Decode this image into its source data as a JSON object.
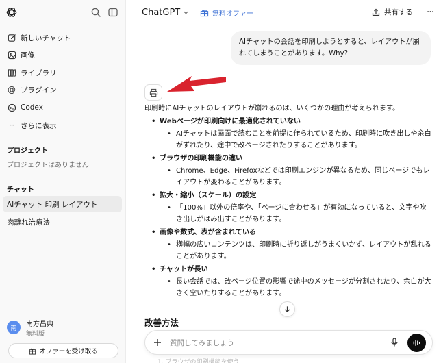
{
  "sidebar": {
    "nav": [
      {
        "label": "新しいチャット",
        "icon": "edit-icon"
      },
      {
        "label": "画像",
        "icon": "image-icon"
      },
      {
        "label": "ライブラリ",
        "icon": "library-icon"
      },
      {
        "label": "プラグイン",
        "icon": "at-icon"
      },
      {
        "label": "Codex",
        "icon": "codex-icon"
      },
      {
        "label": "さらに表示",
        "icon": "dots-icon"
      }
    ],
    "projects_heading": "プロジェクト",
    "projects_empty": "プロジェクトはありません",
    "chats_heading": "チャット",
    "chats": [
      {
        "label": "AIチャット 印刷 レイアウト",
        "active": true
      },
      {
        "label": "肉離れ治療法",
        "active": false
      }
    ],
    "user": {
      "name": "南方昌典",
      "plan": "無料版",
      "avatar_text": "南"
    },
    "offer_button": "オファーを受け取る"
  },
  "header": {
    "model": "ChatGPT",
    "free_offer": "無料オファー",
    "share": "共有する"
  },
  "conversation": {
    "user_message": "AIチャットの会話を印刷しようとすると、レイアウトが崩れてしまうことがあります。Why?",
    "intro": "印刷時にAIチャットのレイアウトが崩れるのは、いくつかの理由が考えられます。",
    "points": [
      {
        "title": "Webページが印刷向けに最適化されていない",
        "detail": "AIチャットは画面で読むことを前提に作られているため、印刷時に吹き出しや余白がずれたり、途中で改ページされたりすることがあります。"
      },
      {
        "title": "ブラウザの印刷機能の違い",
        "detail": "Chrome、Edge、Firefoxなどでは印刷エンジンが異なるため、同じページでもレイアウトが変わることがあります。"
      },
      {
        "title": "拡大・縮小（スケール）の設定",
        "detail": "「100%」以外の倍率や、「ページに合わせる」が有効になっていると、文字や吹き出しがはみ出すことがあります。"
      },
      {
        "title": "画像や数式、表が含まれている",
        "detail": "横幅の広いコンテンツは、印刷時に折り返しがうまくいかず、レイアウトが乱れることがあります。"
      },
      {
        "title": "チャットが長い",
        "detail": "長い会話では、改ページ位置の影響で途中のメッセージが分割されたり、余白が大きく空いたりすることがあります。"
      }
    ],
    "next_heading": "改善方法"
  },
  "composer": {
    "placeholder": "質問してみましょう",
    "cutoff_text": "1. ブラウザの印刷機能を使う"
  },
  "colors": {
    "accent_red": "#d9232e",
    "link_blue": "#3b6fd4"
  }
}
